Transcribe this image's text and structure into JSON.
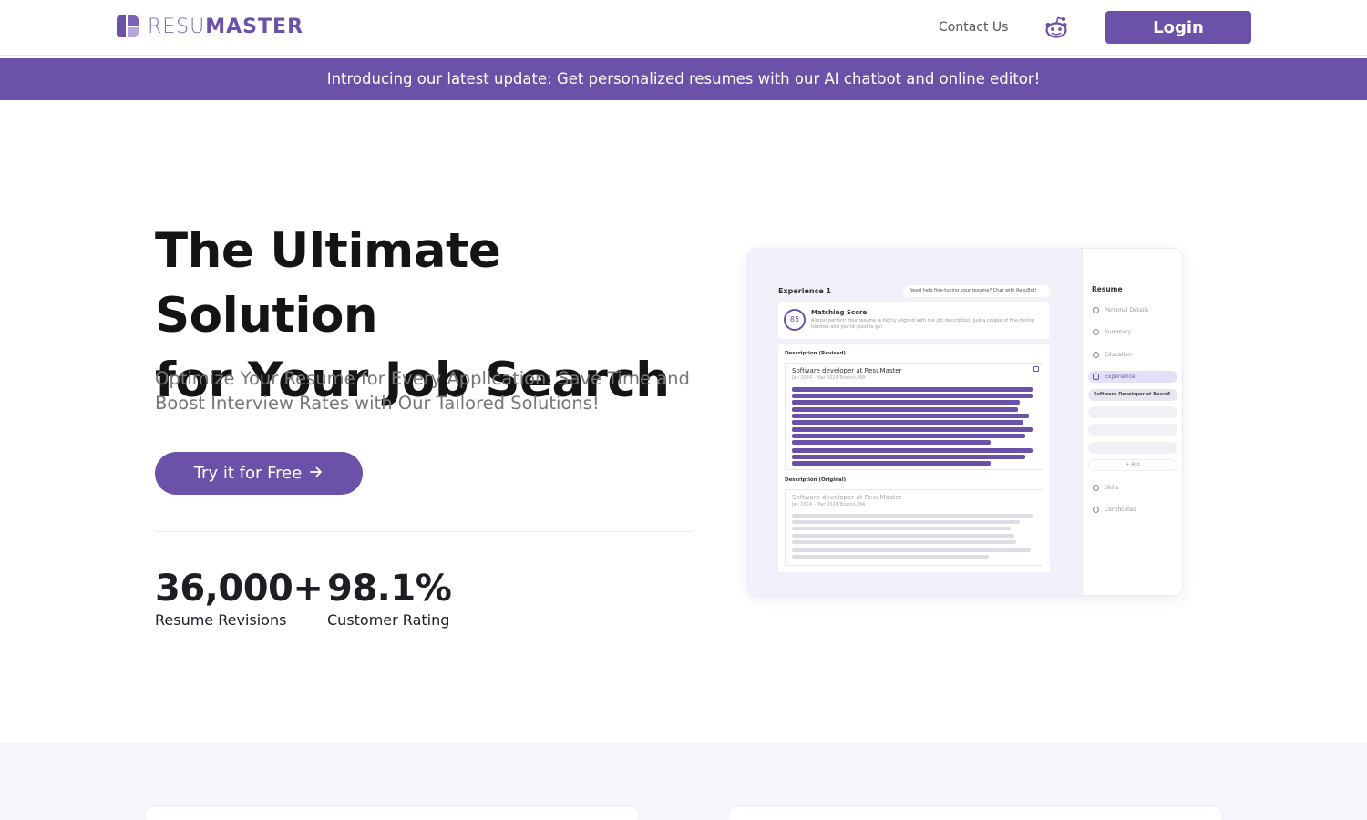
{
  "header": {
    "logo": {
      "part_light": "RESU",
      "part_bold": "MASTER"
    },
    "contact_label": "Contact Us",
    "reddit_icon": "reddit-icon",
    "login_label": "Login"
  },
  "banner": {
    "text": "Introducing our latest update: Get personalized resumes with our AI chatbot and online editor!"
  },
  "hero": {
    "title_line1": "The Ultimate Solution",
    "title_line2": "for Your Job Search",
    "subtitle": "Optimize Your Resume for Every Application: Save Time and Boost Interview Rates with Our Tailored Solutions!",
    "cta_label": "Try it for Free",
    "cta_icon": "arrow-right-icon",
    "stats": [
      {
        "value": "36,000+",
        "label": "Resume Revisions"
      },
      {
        "value": "98.1%",
        "label": "Customer Rating"
      }
    ]
  },
  "mockup": {
    "section_title": "Experience 1",
    "chat_prompt": "Need help fine-tuning your resume? Chat with ResuBot!",
    "score_value": "85",
    "score_title": "Matching Score",
    "score_text": "Almost perfect! Your resume is highly aligned with the job description. Just a couple of fine-tuning touches and you're good to go!",
    "revised_heading": "Description (Revised)",
    "original_heading": "Description (Original)",
    "job_title": "Software developer at ResuMaster",
    "job_meta": "Jan 2024 - Mar 2024   Boston, MA",
    "sidebar_title": "Resume",
    "sidebar_items": [
      {
        "label": "Personal Details",
        "icon": "user-circle-icon"
      },
      {
        "label": "Summary",
        "icon": "lines-icon"
      },
      {
        "label": "Education",
        "icon": "graduation-cap-icon"
      },
      {
        "label": "Experience",
        "icon": "briefcase-icon"
      },
      {
        "label": "Skills",
        "icon": "lightning-icon"
      },
      {
        "label": "Certificates",
        "icon": "badge-icon"
      }
    ],
    "sidebar_sub": "Software Developer at ResuM",
    "sidebar_add": "+ Add"
  },
  "colors": {
    "brand": "#6b52a8",
    "banner_bg": "#6b52a8",
    "section_bg": "#f7f6fd"
  }
}
